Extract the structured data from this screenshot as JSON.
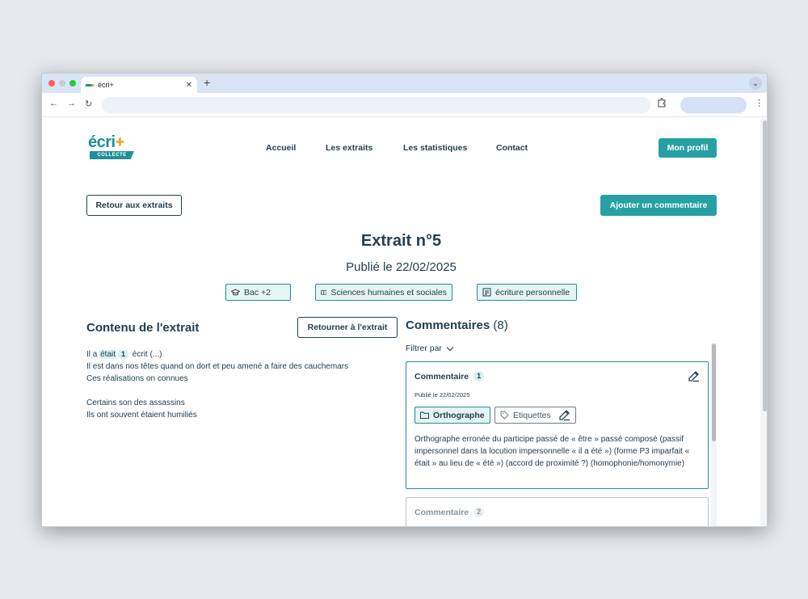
{
  "browser": {
    "tab_title": "écri+",
    "new_tab": "+",
    "close": "✕",
    "menu": "⌄",
    "back": "←",
    "forward": "→",
    "reload": "↻",
    "kebab": "⋮"
  },
  "logo": {
    "main": "écri",
    "plus": "+",
    "band": "COLLECTE"
  },
  "nav": {
    "items": [
      "Accueil",
      "Les extraits",
      "Les statistiques",
      "Contact"
    ],
    "profile": "Mon profil"
  },
  "actions": {
    "back": "Retour aux extraits",
    "add_comment": "Ajouter un commentaire"
  },
  "extract": {
    "title": "Extrait n°5",
    "published": "Publié le 22/02/2025",
    "chips": [
      "Bac +2",
      "Sciences humaines et sociales",
      "écriture personnelle"
    ]
  },
  "content": {
    "heading": "Contenu de l'extrait",
    "return_button": "Retourner à l'extrait",
    "line1_before": "Il a ",
    "line1_highlight": "était",
    "line1_badge": "1",
    "line1_after": " écrit (...)",
    "lines": [
      "Il est dans nos têtes quand on dort et peu amené a faire des cauchemars",
      "Ces réalisations on connues",
      "",
      "Certains son des assassins",
      "Ils ont souvent étaient humiliés"
    ]
  },
  "comments": {
    "heading": "Commentaires",
    "count": "(8)",
    "filter": "Filtrer par",
    "items": [
      {
        "title": "Commentaire",
        "number": "1",
        "date": "Publié le 22/02/2025",
        "category": "Orthographe",
        "tags_label": "Etiquettes",
        "body": "Orthographe erronée du participe passé de « être » passé composé (passif impersonnel dans la locution impersonnelle « il a été ») (forme P3 imparfait « était » au lieu de « été ») (accord de proximité ?) (homophonie/homonymie)"
      },
      {
        "title": "Commentaire",
        "number": "2"
      }
    ]
  },
  "colors": {
    "teal": "#27a0a3",
    "dark": "#23404f",
    "orange": "#f39a1c"
  }
}
